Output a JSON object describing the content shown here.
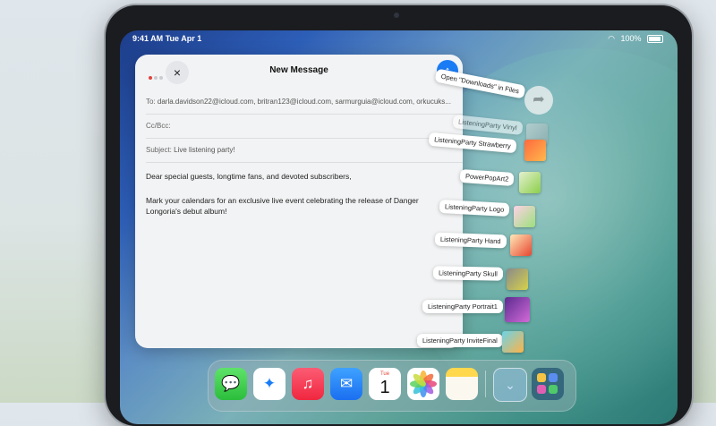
{
  "status_bar": {
    "time": "9:41 AM",
    "date": "Tue Apr 1",
    "battery": "100%",
    "wifi_icon": "wifi-icon"
  },
  "compose": {
    "title": "New Message",
    "close_icon": "×",
    "send_icon": "↑",
    "to_label": "To:",
    "to_value": "darla.davidson22@icloud.com, britran123@icloud.com, sarmurguia@icloud.com, orkucuks...",
    "cc_label": "Cc/Bcc:",
    "subject_label": "Subject:",
    "subject_value": "Live listening party!",
    "body_line1": "Dear special guests, longtime fans, and devoted subscribers,",
    "body_line2": "Mark your calendars for an exclusive live event celebrating the release of Danger Longoria's debut album!"
  },
  "drag": {
    "open_in_files": "Open \"Downloads\" in Files",
    "items": [
      "ListeningParty Vinyl",
      "ListeningParty Strawberry",
      "PowerPopArt2",
      "ListeningParty Logo",
      "ListeningParty Hand",
      "ListeningParty Skull",
      "ListeningParty Portrait1",
      "ListeningParty InviteFinal"
    ]
  },
  "dock": {
    "apps": [
      "Messages",
      "Safari",
      "Music",
      "Mail",
      "Calendar",
      "Photos",
      "Notes",
      "Downloads",
      "App Library"
    ],
    "calendar_day": "Tue",
    "calendar_date": "1"
  }
}
